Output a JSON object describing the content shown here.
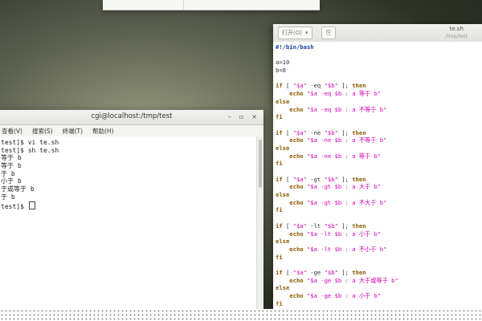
{
  "terminal": {
    "title": "cgi@localhost:/tmp/test",
    "window_buttons": [
      "–",
      "▫",
      "×"
    ],
    "menu": [
      "查看(V)",
      "搜索(S)",
      "终端(T)",
      "帮助(H)"
    ],
    "lines": [
      "test]$ vi te.sh",
      "test]$ sh te.sh",
      "等于 b",
      "等于 b",
      "于 b",
      "小于 b",
      "于或等于 b",
      "于 b",
      "test]$ "
    ]
  },
  "editor": {
    "open_label": "打开(O)",
    "open_arrow": "▾",
    "save_icon_glyph": "⎘",
    "file_name": "te.sh",
    "file_path": "/tmp/test",
    "code": [
      [
        {
          "c": "#!/bin/bash",
          "t": "shebang"
        }
      ],
      [],
      [
        {
          "c": "a=10",
          "t": "plain"
        }
      ],
      [
        {
          "c": "b=8",
          "t": "plain"
        }
      ],
      [],
      [
        {
          "c": "if",
          "t": "kw"
        },
        {
          "c": " [ ",
          "t": "plain"
        },
        {
          "c": "\"$a\"",
          "t": "str"
        },
        {
          "c": " -eq ",
          "t": "plain"
        },
        {
          "c": "\"$b\"",
          "t": "str"
        },
        {
          "c": " ]; ",
          "t": "plain"
        },
        {
          "c": "then",
          "t": "kw"
        }
      ],
      [
        {
          "c": "    echo ",
          "t": "kw"
        },
        {
          "c": "\"$a -eq $b : a 等于 b\"",
          "t": "str"
        }
      ],
      [
        {
          "c": "else",
          "t": "kw"
        }
      ],
      [
        {
          "c": "    echo ",
          "t": "kw"
        },
        {
          "c": "\"$a -eq $b : a 不等于 b\"",
          "t": "str"
        }
      ],
      [
        {
          "c": "fi",
          "t": "kw"
        }
      ],
      [],
      [
        {
          "c": "if",
          "t": "kw"
        },
        {
          "c": " [ ",
          "t": "plain"
        },
        {
          "c": "\"$a\"",
          "t": "str"
        },
        {
          "c": " -ne ",
          "t": "plain"
        },
        {
          "c": "\"$b\"",
          "t": "str"
        },
        {
          "c": " ]; ",
          "t": "plain"
        },
        {
          "c": "then",
          "t": "kw"
        }
      ],
      [
        {
          "c": "    echo ",
          "t": "kw"
        },
        {
          "c": "\"$a -ne $b : a 不等于 b\"",
          "t": "str"
        }
      ],
      [
        {
          "c": "else",
          "t": "kw"
        }
      ],
      [
        {
          "c": "    echo ",
          "t": "kw"
        },
        {
          "c": "\"$a -ne $b : a 等于 b\"",
          "t": "str"
        }
      ],
      [
        {
          "c": "fi",
          "t": "kw"
        }
      ],
      [],
      [
        {
          "c": "if",
          "t": "kw"
        },
        {
          "c": " [ ",
          "t": "plain"
        },
        {
          "c": "\"$a\"",
          "t": "str"
        },
        {
          "c": " -gt ",
          "t": "plain"
        },
        {
          "c": "\"$b\"",
          "t": "str"
        },
        {
          "c": " ]; ",
          "t": "plain"
        },
        {
          "c": "then",
          "t": "kw"
        }
      ],
      [
        {
          "c": "    echo ",
          "t": "kw"
        },
        {
          "c": "\"$a -gt $b : a 大于 b\"",
          "t": "str"
        }
      ],
      [
        {
          "c": "else",
          "t": "kw"
        }
      ],
      [
        {
          "c": "    echo ",
          "t": "kw"
        },
        {
          "c": "\"$a -gt $b : a 不大于 b\"",
          "t": "str"
        }
      ],
      [
        {
          "c": "fi",
          "t": "kw"
        }
      ],
      [],
      [
        {
          "c": "if",
          "t": "kw"
        },
        {
          "c": " [ ",
          "t": "plain"
        },
        {
          "c": "\"$a\"",
          "t": "str"
        },
        {
          "c": " -lt ",
          "t": "plain"
        },
        {
          "c": "\"$b\"",
          "t": "str"
        },
        {
          "c": " ]; ",
          "t": "plain"
        },
        {
          "c": "then",
          "t": "kw"
        }
      ],
      [
        {
          "c": "    echo ",
          "t": "kw"
        },
        {
          "c": "\"$a -lt $b : a 小于 b\"",
          "t": "str"
        }
      ],
      [
        {
          "c": "else",
          "t": "kw"
        }
      ],
      [
        {
          "c": "    echo ",
          "t": "kw"
        },
        {
          "c": "\"$a -lt $b : a 不小于 b\"",
          "t": "str"
        }
      ],
      [
        {
          "c": "fi",
          "t": "kw"
        }
      ],
      [],
      [
        {
          "c": "if",
          "t": "kw"
        },
        {
          "c": " [ ",
          "t": "plain"
        },
        {
          "c": "\"$a\"",
          "t": "str"
        },
        {
          "c": " -ge ",
          "t": "plain"
        },
        {
          "c": "\"$b\"",
          "t": "str"
        },
        {
          "c": " ]; ",
          "t": "plain"
        },
        {
          "c": "then",
          "t": "kw"
        }
      ],
      [
        {
          "c": "    echo ",
          "t": "kw"
        },
        {
          "c": "\"$a -ge $b : a 大于或等于 b\"",
          "t": "str"
        }
      ],
      [
        {
          "c": "else",
          "t": "kw"
        }
      ],
      [
        {
          "c": "    echo ",
          "t": "kw"
        },
        {
          "c": "\"$a -ge $b : a 小于 b\"",
          "t": "str"
        }
      ],
      [
        {
          "c": "fi",
          "t": "kw"
        }
      ]
    ]
  },
  "colors": {
    "keyword": "#8a5a00",
    "string": "#d400b4",
    "shebang": "#1a3ea0"
  }
}
